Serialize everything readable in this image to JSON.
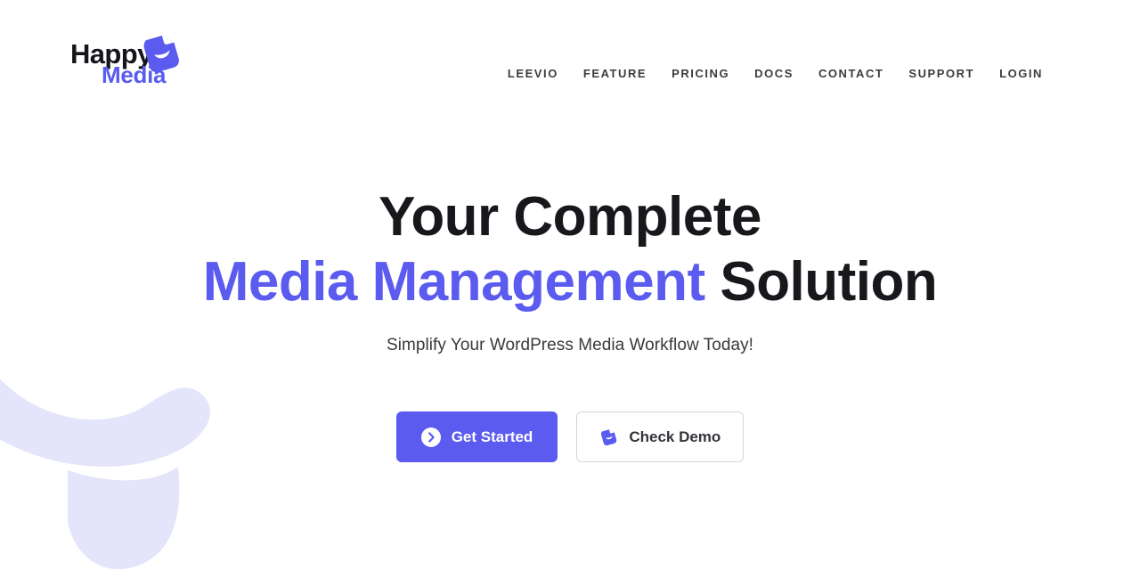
{
  "brand": {
    "name_part1": "Happy",
    "name_part2": "Media",
    "mark_icon": "happy-media-logo-mark",
    "color_dark": "#14161a",
    "color_accent": "#5b5bf0"
  },
  "nav": {
    "items": [
      {
        "label": "LEEVIO"
      },
      {
        "label": "FEATURE"
      },
      {
        "label": "PRICING"
      },
      {
        "label": "DOCS"
      },
      {
        "label": "CONTACT"
      },
      {
        "label": "SUPPORT"
      },
      {
        "label": "LOGIN"
      }
    ]
  },
  "hero": {
    "title_line1": "Your Complete",
    "title_line2_accent": "Media Management",
    "title_line2_rest": " Solution",
    "subtitle": "Simplify Your WordPress Media Workflow Today!",
    "primary_cta": {
      "label": "Get Started",
      "icon": "circle-arrow-right-icon",
      "bg": "#5b5bf0",
      "text": "#ffffff"
    },
    "secondary_cta": {
      "label": "Check Demo",
      "icon": "happy-media-logo-mark",
      "bg": "#ffffff",
      "text": "#33353a",
      "border": "#d6d6d6"
    }
  },
  "decoration": {
    "shape": "smile-arc-and-tongue",
    "color": "#e4e4fa"
  }
}
